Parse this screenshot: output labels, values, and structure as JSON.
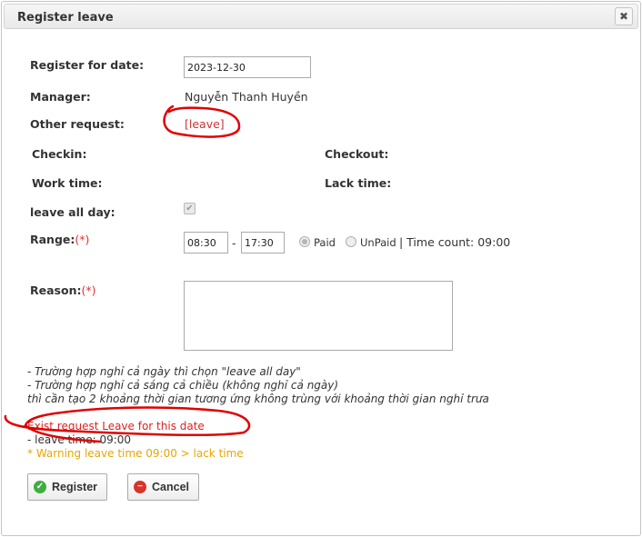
{
  "dialog": {
    "title": "Register leave",
    "close_symbol": "✖"
  },
  "form": {
    "register_for_date_label": "Register for date:",
    "register_for_date_value": "2023-12-30",
    "manager_label": "Manager:",
    "manager_value": "Nguyễn Thanh Huyền",
    "other_request_label": "Other request:",
    "other_request_value": "[leave]",
    "checkin_label": "Checkin:",
    "checkout_label": "Checkout:",
    "work_time_label": "Work time:",
    "lack_time_label": "Lack time:",
    "leave_all_day_label": "leave all day:",
    "leave_all_day_checked": true,
    "range_label": "Range:",
    "required_mark": "(*)",
    "range_from": "08:30",
    "range_separator": "-",
    "range_to": "17:30",
    "paid_label": "Paid",
    "unpaid_label": "UnPaid",
    "paid_selected": true,
    "time_count_text": "| Time count: 09:00",
    "reason_label": "Reason:",
    "reason_value": ""
  },
  "notes": [
    "- Trường hợp nghỉ cả ngày thì chọn \"leave all day\"",
    "- Trường hợp nghỉ cả sáng cả chiều (không nghỉ cả ngày)",
    "thì cần tạo 2 khoảng thời gian tương ứng không trùng với khoảng thời gian nghỉ trưa"
  ],
  "messages": {
    "error": "Exist request Leave for this date",
    "leave_time": "- leave time: 09:00",
    "warning": "* Warning leave time 09:00 > lack time"
  },
  "buttons": {
    "register": "Register",
    "cancel": "Cancel"
  },
  "colors": {
    "required": "#dd3333",
    "error": "#dd2222",
    "warning": "#e6a700",
    "annotation": "#e00000"
  }
}
